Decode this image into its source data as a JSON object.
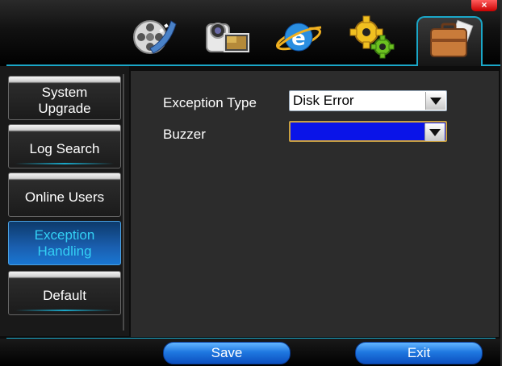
{
  "window": {
    "close_label": "×"
  },
  "toolbar": {
    "icons": [
      "film-reel-icon",
      "camcorder-icon",
      "ie-globe-icon",
      "gears-icon",
      "briefcase-icon"
    ],
    "active_index": 4
  },
  "sidebar": {
    "items": [
      {
        "line1": "System",
        "line2": "Upgrade",
        "active": false
      },
      {
        "line1": "Log Search",
        "line2": "",
        "active": false
      },
      {
        "line1": "Online Users",
        "line2": "",
        "active": false
      },
      {
        "line1": "Exception",
        "line2": "Handling",
        "active": true
      },
      {
        "line1": "Default",
        "line2": "",
        "active": false
      }
    ]
  },
  "form": {
    "exception_type_label": "Exception Type",
    "exception_type_value": "Disk Error",
    "buzzer_label": "Buzzer",
    "buzzer_value": ""
  },
  "buttons": {
    "save": "Save",
    "exit": "Exit"
  },
  "colors": {
    "accent": "#1aa7c8",
    "active_text": "#33d0f5",
    "buzzer_fill": "#0a14e8"
  }
}
